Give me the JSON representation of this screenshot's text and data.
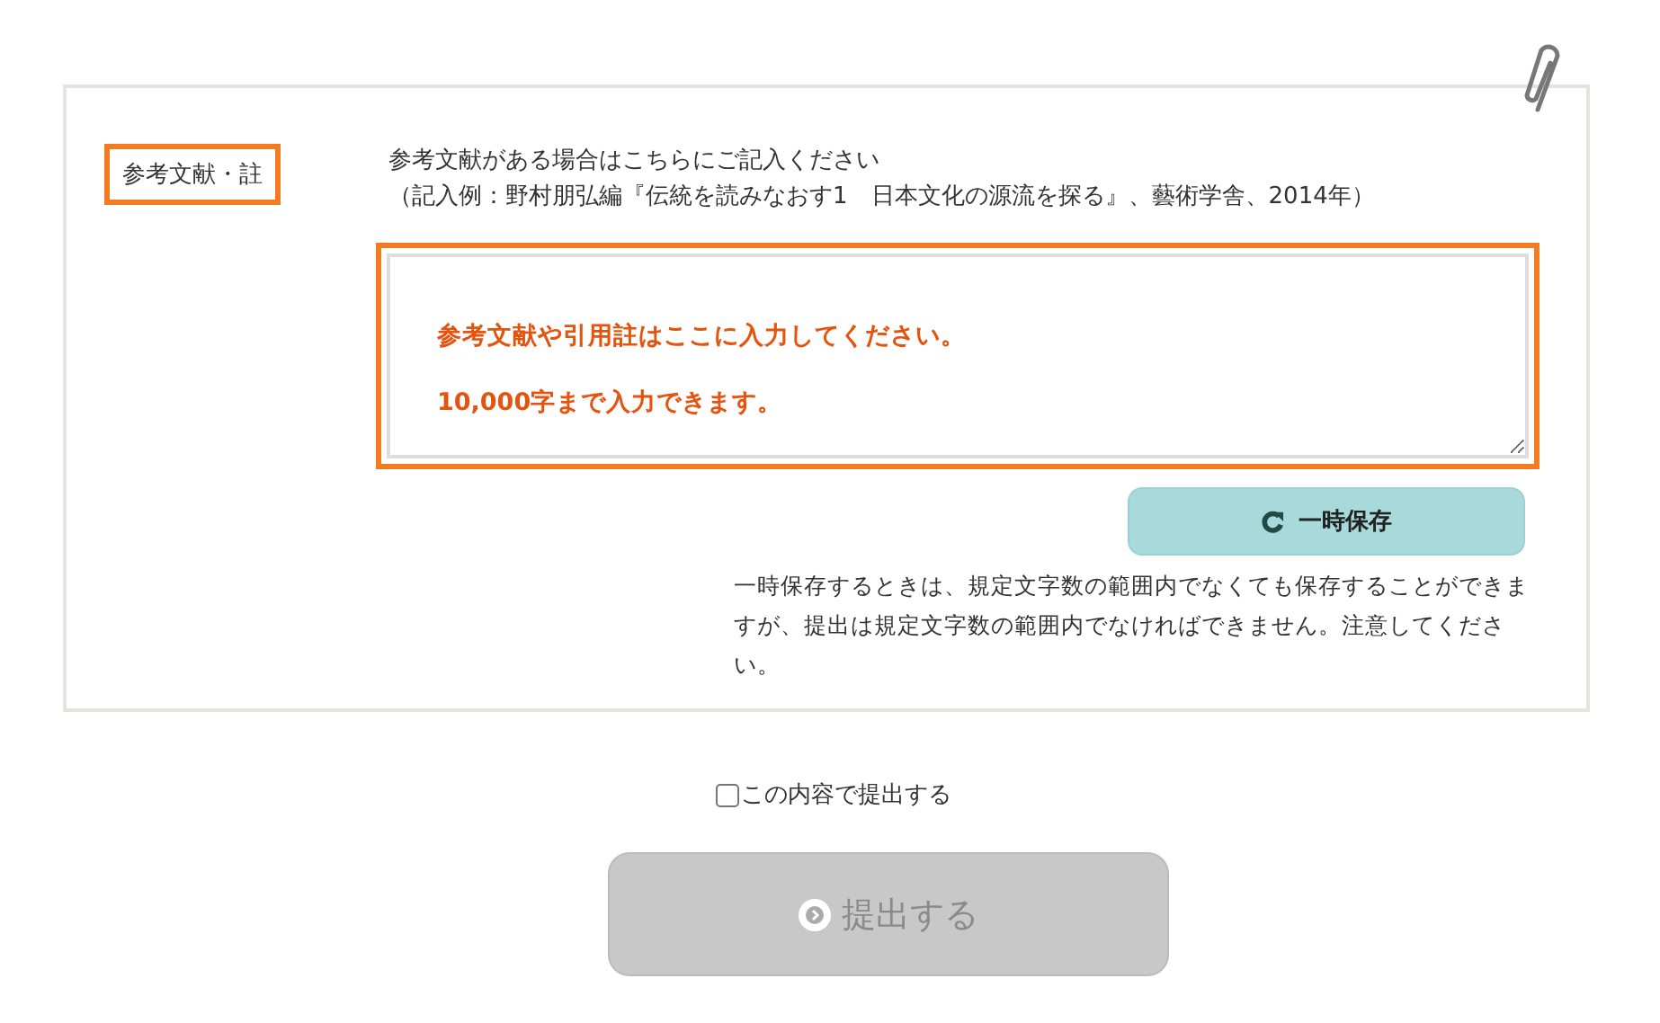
{
  "section": {
    "label": "参考文献・註",
    "instruction": [
      "参考文献がある場合はこちらにご記入ください",
      "（記入例：野村朋弘編『伝統を読みなおす1　日本文化の源流を探る』、藝術学舎、2014年）"
    ],
    "textarea": {
      "placeholder": "参考文献や引用註はここに入力してください。\n10,000字まで入力できます。"
    },
    "save_button": {
      "label": "一時保存"
    },
    "note": "一時保存するときは、規定文字数の範囲内でなくても保存することができますが、提出は規定文字数の範囲内でなければできません。注意してください。"
  },
  "confirm": {
    "label": "この内容で提出する",
    "checked": false
  },
  "submit_button": {
    "label": "提出する",
    "disabled": true
  }
}
